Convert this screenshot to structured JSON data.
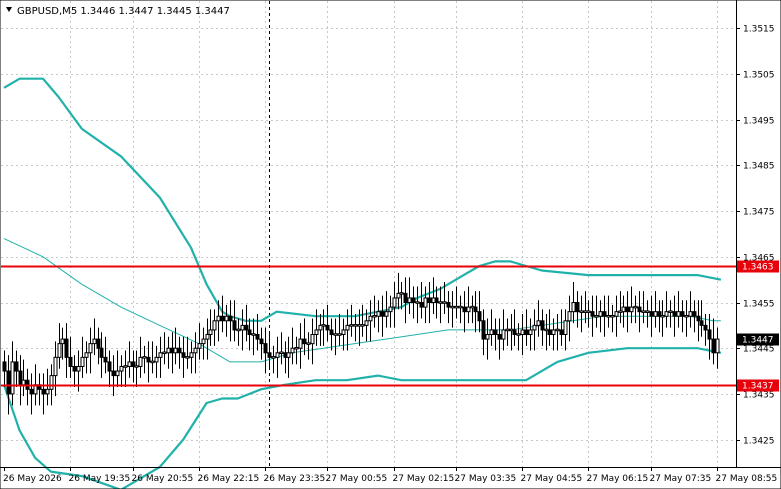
{
  "chart_data": {
    "type": "candlestick",
    "title": "GBPUSD,M5  1.3446 1.3447 1.3445 1.3447",
    "symbol": "GBPUSD",
    "timeframe": "M5",
    "ohlc_header": {
      "open": 1.3446,
      "high": 1.3447,
      "low": 1.3445,
      "close": 1.3447
    },
    "ylim": [
      1.3419,
      1.3521
    ],
    "y_ticks": [
      1.3515,
      1.3505,
      1.3495,
      1.3485,
      1.3475,
      1.3465,
      1.3455,
      1.3445,
      1.3435,
      1.3425
    ],
    "y_tick_labels": [
      "1.3515",
      "1.3505",
      "1.3495",
      "1.3485",
      "1.3475",
      "1.3465",
      "1.3455",
      "1.3445",
      "1.3435",
      "1.3425"
    ],
    "x_tick_labels": [
      "26 May 2026",
      "26 May 19:35",
      "26 May 20:55",
      "26 May 22:15",
      "26 May 23:35",
      "27 May 00:55",
      "27 May 02:15",
      "27 May 03:35",
      "27 May 04:55",
      "27 May 06:15",
      "27 May 07:35",
      "27 May 08:55"
    ],
    "grid": true,
    "vertical_marker_bar": 68,
    "current_price": "1.3447",
    "horizontal_levels": [
      {
        "label": "1.3463",
        "value": 1.3463,
        "color": "#e8000b"
      },
      {
        "label": "1.3437",
        "value": 1.3437,
        "color": "#e8000b"
      }
    ],
    "candles_close": [
      1.344,
      1.3435,
      1.3442,
      1.344,
      1.3437,
      1.3438,
      1.3436,
      1.3435,
      1.3437,
      1.3436,
      1.3435,
      1.3436,
      1.3439,
      1.3443,
      1.3446,
      1.3447,
      1.3443,
      1.3441,
      1.344,
      1.3441,
      1.3443,
      1.3444,
      1.3446,
      1.3447,
      1.3445,
      1.3443,
      1.3442,
      1.344,
      1.3439,
      1.344,
      1.3441,
      1.3441,
      1.3442,
      1.3441,
      1.3441,
      1.3443,
      1.3443,
      1.3442,
      1.3442,
      1.3443,
      1.3444,
      1.3444,
      1.3445,
      1.3444,
      1.3445,
      1.3444,
      1.3443,
      1.3443,
      1.3444,
      1.3445,
      1.3446,
      1.3447,
      1.3448,
      1.3449,
      1.3451,
      1.3452,
      1.3451,
      1.3452,
      1.3451,
      1.3449,
      1.3449,
      1.345,
      1.3449,
      1.3448,
      1.3448,
      1.3447,
      1.3446,
      1.3444,
      1.3443,
      1.3443,
      1.3444,
      1.3444,
      1.3443,
      1.3444,
      1.3445,
      1.3445,
      1.3447,
      1.3446,
      1.3446,
      1.3448,
      1.3449,
      1.345,
      1.345,
      1.3449,
      1.3448,
      1.3448,
      1.3448,
      1.3449,
      1.345,
      1.345,
      1.345,
      1.345,
      1.345,
      1.3451,
      1.3452,
      1.3452,
      1.3453,
      1.3452,
      1.3453,
      1.3454,
      1.3456,
      1.3457,
      1.3457,
      1.3455,
      1.3456,
      1.3455,
      1.3455,
      1.3454,
      1.3456,
      1.3455,
      1.3456,
      1.3455,
      1.3455,
      1.3455,
      1.3454,
      1.3454,
      1.3454,
      1.3454,
      1.3453,
      1.3454,
      1.3454,
      1.3453,
      1.3451,
      1.3447,
      1.3448,
      1.3449,
      1.3448,
      1.3447,
      1.3449,
      1.3449,
      1.3449,
      1.3448,
      1.3448,
      1.3449,
      1.3448,
      1.3449,
      1.345,
      1.3451,
      1.3449,
      1.3449,
      1.3448,
      1.3449,
      1.3449,
      1.3448,
      1.3451,
      1.3453,
      1.3455,
      1.3453,
      1.3453,
      1.3453,
      1.3453,
      1.3452,
      1.3452,
      1.3453,
      1.3452,
      1.3452,
      1.3452,
      1.3453,
      1.3453,
      1.3454,
      1.3453,
      1.3454,
      1.3454,
      1.3453,
      1.3453,
      1.3453,
      1.3452,
      1.3453,
      1.3452,
      1.3452,
      1.3453,
      1.3453,
      1.3452,
      1.3453,
      1.3452,
      1.3452,
      1.3453,
      1.3452,
      1.3451,
      1.345,
      1.3449,
      1.3447,
      1.3444,
      1.3447
    ],
    "series": [
      {
        "name": "bollinger_upper",
        "color": "#20b2aa",
        "x_bars": [
          0,
          4,
          10,
          14,
          20,
          30,
          40,
          48,
          52,
          56,
          58,
          62,
          66,
          70,
          80,
          90,
          96,
          102,
          106,
          112,
          118,
          122,
          126,
          130,
          134,
          138,
          150,
          160,
          170,
          178,
          184
        ],
        "values": [
          1.3502,
          1.3504,
          1.3504,
          1.35,
          1.3493,
          1.3487,
          1.3478,
          1.3467,
          1.3459,
          1.3453,
          1.3452,
          1.3451,
          1.3451,
          1.3453,
          1.3452,
          1.3452,
          1.3453,
          1.3454,
          1.3456,
          1.3458,
          1.3461,
          1.3463,
          1.3464,
          1.3464,
          1.3463,
          1.3462,
          1.3461,
          1.3461,
          1.3461,
          1.3461,
          1.346
        ]
      },
      {
        "name": "bollinger_middle",
        "color": "#20b2aa",
        "x_bars": [
          0,
          10,
          20,
          30,
          40,
          50,
          58,
          66,
          74,
          82,
          90,
          98,
          106,
          114,
          122,
          130,
          138,
          146,
          154,
          162,
          170,
          176,
          182,
          184
        ],
        "values": [
          1.3469,
          1.3465,
          1.3459,
          1.3454,
          1.345,
          1.3446,
          1.3442,
          1.3442,
          1.3444,
          1.3445,
          1.3446,
          1.3447,
          1.3448,
          1.3449,
          1.3449,
          1.3449,
          1.345,
          1.3451,
          1.3452,
          1.3452,
          1.3452,
          1.3452,
          1.3451,
          1.3451
        ]
      },
      {
        "name": "bollinger_lower",
        "color": "#20b2aa",
        "x_bars": [
          0,
          4,
          8,
          12,
          20,
          30,
          40,
          46,
          52,
          56,
          60,
          66,
          72,
          80,
          88,
          96,
          102,
          106,
          112,
          118,
          124,
          130,
          134,
          138,
          142,
          150,
          160,
          170,
          178,
          184
        ],
        "values": [
          1.3437,
          1.3427,
          1.3421,
          1.3418,
          1.3417,
          1.3414,
          1.3419,
          1.3425,
          1.3433,
          1.3434,
          1.3434,
          1.3436,
          1.3437,
          1.3438,
          1.3438,
          1.3439,
          1.3438,
          1.3438,
          1.3438,
          1.3438,
          1.3438,
          1.3438,
          1.3438,
          1.344,
          1.3442,
          1.3444,
          1.3445,
          1.3445,
          1.3445,
          1.3444
        ]
      }
    ]
  }
}
